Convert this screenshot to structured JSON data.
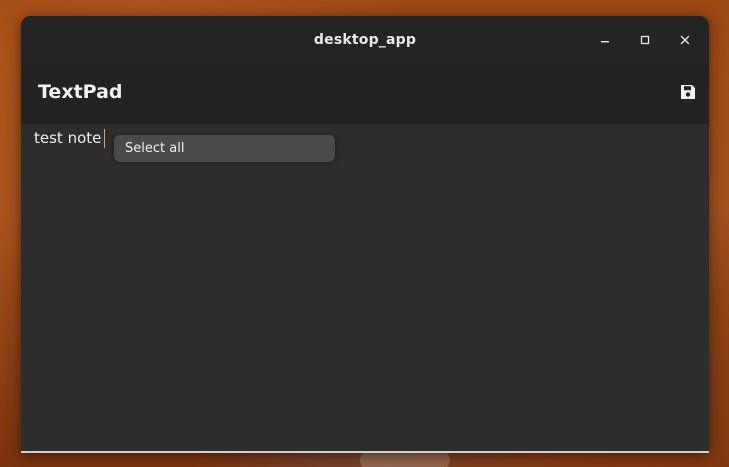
{
  "window": {
    "title": "desktop_app",
    "controls": {
      "minimize_icon": "minimize-icon",
      "maximize_icon": "maximize-icon",
      "close_icon": "close-icon"
    }
  },
  "app": {
    "title": "TextPad",
    "save_icon": "save-icon"
  },
  "editor": {
    "content": "test note "
  },
  "context_menu": {
    "items": [
      {
        "label": "Select all"
      }
    ]
  },
  "colors": {
    "titlebar_bg": "#242424",
    "header_bg": "#222222",
    "editor_bg": "#2d2d2d",
    "menu_bg": "#4a4a4a",
    "text": "#f0f0f0"
  }
}
